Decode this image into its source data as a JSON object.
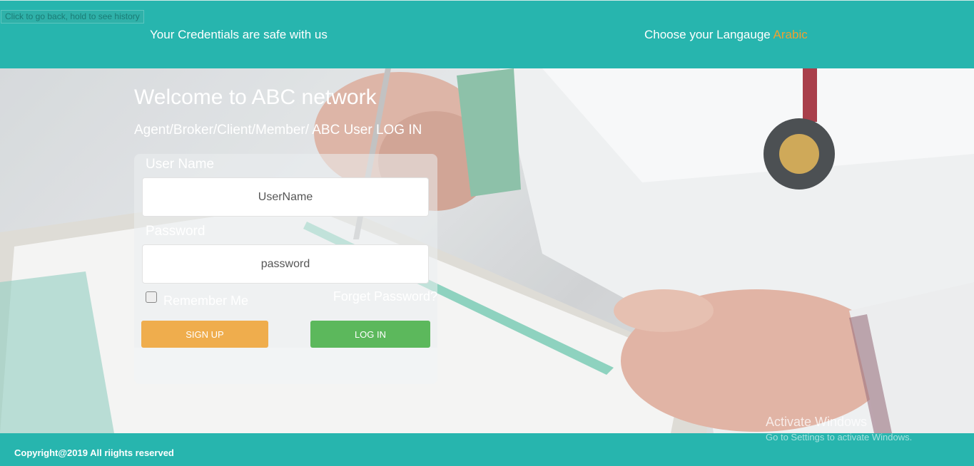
{
  "browser": {
    "back_tooltip": "Click to go back, hold to see history"
  },
  "header": {
    "tagline": "Your Credentials are safe with us",
    "language_prompt": "Choose your Langauge",
    "language_option": "Arabic",
    "language_color": "#f0a030"
  },
  "main": {
    "title": "Welcome to ABC network",
    "subtitle": "Agent/Broker/Client/Member/ ABC User LOG IN"
  },
  "login_form": {
    "username_label": "User Name",
    "username_placeholder": "UserName",
    "password_label": "Password",
    "password_placeholder": "password",
    "remember_label": "Remember Me",
    "remember_checked": false,
    "forgot_label": "Forget Password?",
    "signup_label": "SIGN UP",
    "login_label": "LOG IN",
    "signup_color": "#efad4d",
    "login_color": "#5cb85c"
  },
  "footer": {
    "copyright": "Copyright@2019 All riights reserved"
  },
  "watermark": {
    "title": "Activate Windows",
    "subtitle": "Go to Settings to activate Windows."
  },
  "theme": {
    "brand": "#27b5ae"
  }
}
